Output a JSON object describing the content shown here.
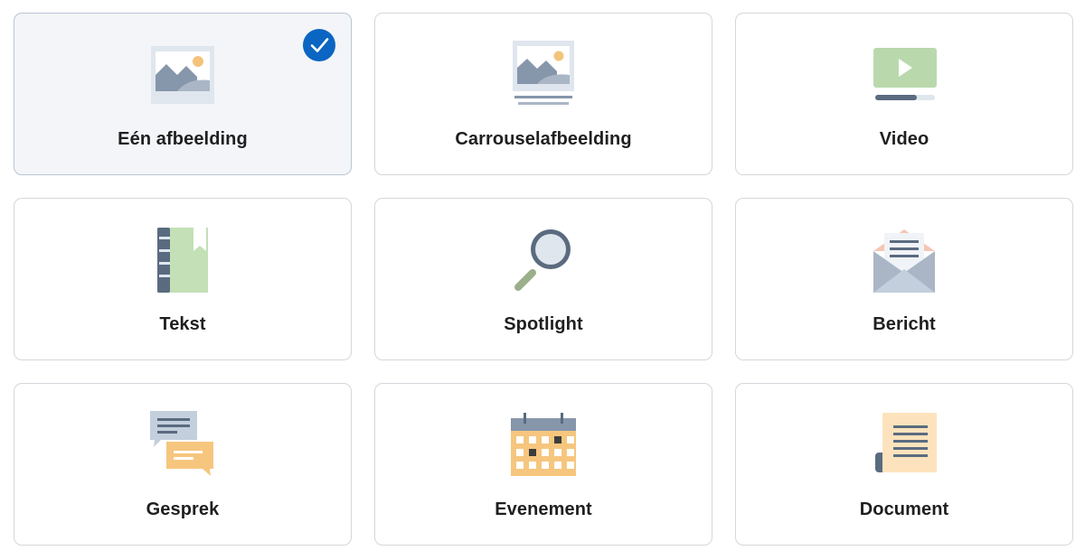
{
  "colors": {
    "selected_accent": "#0a66c2",
    "card_border": "#d4d7db",
    "selected_background": "#f3f5f8"
  },
  "cards": [
    {
      "label": "Eén afbeelding",
      "icon": "image-icon",
      "selected": true
    },
    {
      "label": "Carrouselafbeelding",
      "icon": "carousel-image-icon",
      "selected": false
    },
    {
      "label": "Video",
      "icon": "video-icon",
      "selected": false
    },
    {
      "label": "Tekst",
      "icon": "notebook-icon",
      "selected": false
    },
    {
      "label": "Spotlight",
      "icon": "magnifier-icon",
      "selected": false
    },
    {
      "label": "Bericht",
      "icon": "envelope-icon",
      "selected": false
    },
    {
      "label": "Gesprek",
      "icon": "chat-bubbles-icon",
      "selected": false
    },
    {
      "label": "Evenement",
      "icon": "calendar-icon",
      "selected": false
    },
    {
      "label": "Document",
      "icon": "document-icon",
      "selected": false
    }
  ]
}
